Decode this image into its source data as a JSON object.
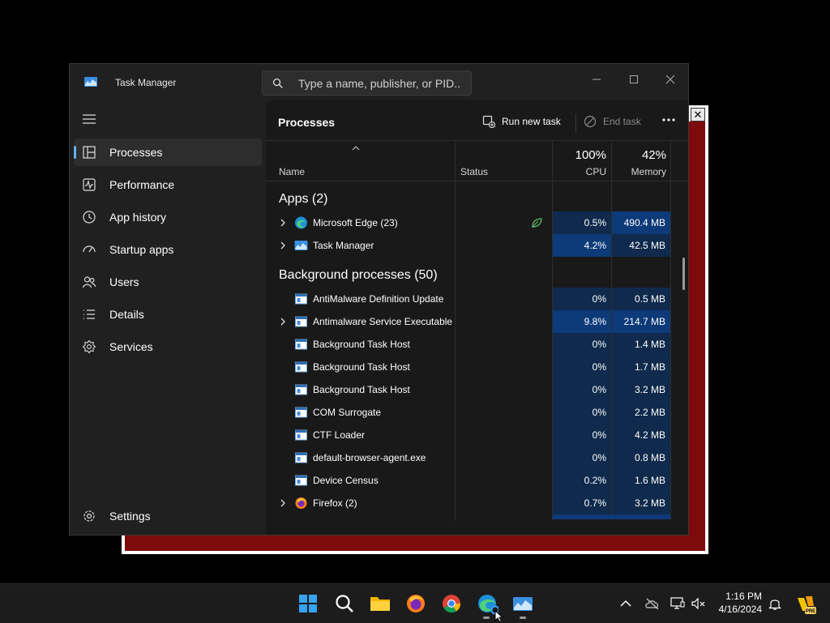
{
  "background_window": {
    "close_label": "✕"
  },
  "window": {
    "title": "Task Manager",
    "search_placeholder": "Type a name, publisher, or PID...",
    "minimize_icon": "minimize-icon",
    "maximize_icon": "maximize-icon",
    "close_icon": "close-icon"
  },
  "sidebar": {
    "items": [
      {
        "label": "Processes",
        "icon": "processes-icon",
        "active": true
      },
      {
        "label": "Performance",
        "icon": "performance-icon"
      },
      {
        "label": "App history",
        "icon": "app-history-icon"
      },
      {
        "label": "Startup apps",
        "icon": "startup-apps-icon"
      },
      {
        "label": "Users",
        "icon": "users-icon"
      },
      {
        "label": "Details",
        "icon": "details-icon"
      },
      {
        "label": "Services",
        "icon": "services-icon"
      }
    ],
    "settings_label": "Settings"
  },
  "toolbar": {
    "title": "Processes",
    "run_new_task": "Run new task",
    "end_task": "End task"
  },
  "table": {
    "col_name": "Name",
    "col_status": "Status",
    "cpu_total": "100%",
    "cpu_label": "CPU",
    "mem_total": "42%",
    "mem_label": "Memory",
    "apps_header": "Apps (2)",
    "bg_header": "Background processes (50)",
    "apps": [
      {
        "name": "Microsoft Edge (23)",
        "cpu": "0.5%",
        "mem": "490.4 MB",
        "icon": "edge-icon",
        "expandable": true,
        "status_icon": "efficiency-mode-leaf-icon",
        "mem_hi": true
      },
      {
        "name": "Task Manager",
        "cpu": "4.2%",
        "mem": "42.5 MB",
        "icon": "task-manager-icon",
        "expandable": true,
        "cpu_hi": true
      }
    ],
    "background": [
      {
        "name": "AntiMalware Definition Update",
        "cpu": "0%",
        "mem": "0.5 MB"
      },
      {
        "name": "Antimalware Service Executable",
        "cpu": "9.8%",
        "mem": "214.7 MB",
        "expandable": true,
        "cpu_hi": true,
        "mem_hi": true
      },
      {
        "name": "Background Task Host",
        "cpu": "0%",
        "mem": "1.4 MB"
      },
      {
        "name": "Background Task Host",
        "cpu": "0%",
        "mem": "1.7 MB"
      },
      {
        "name": "Background Task Host",
        "cpu": "0%",
        "mem": "3.2 MB"
      },
      {
        "name": "COM Surrogate",
        "cpu": "0%",
        "mem": "2.2 MB"
      },
      {
        "name": "CTF Loader",
        "cpu": "0%",
        "mem": "4.2 MB"
      },
      {
        "name": "default-browser-agent.exe",
        "cpu": "0%",
        "mem": "0.8 MB"
      },
      {
        "name": "Device Census",
        "cpu": "0.2%",
        "mem": "1.6 MB"
      },
      {
        "name": "Firefox (2)",
        "cpu": "0.7%",
        "mem": "3.2 MB",
        "expandable": true,
        "icon": "firefox-icon"
      }
    ]
  },
  "taskbar": {
    "apps": [
      "start-icon",
      "search-icon",
      "file-explorer-icon",
      "firefox-icon",
      "chrome-icon",
      "edge-icon",
      "task-manager-icon"
    ],
    "time": "1:16 PM",
    "date": "4/16/2024",
    "colors": {
      "accent": "#5fb2f2",
      "cpu_fill": "#0f2a4c",
      "cpu_fill_high": "#0d3a78"
    }
  }
}
